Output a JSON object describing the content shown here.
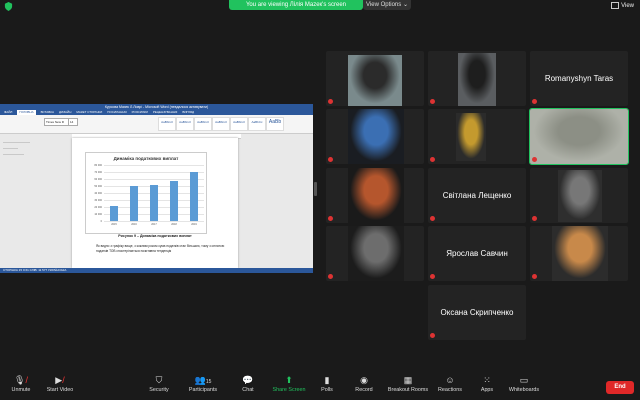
{
  "top": {
    "banner": "You are viewing Лілія Маzeк's screen",
    "view_options": "View Options ⌄",
    "view_label": "View"
  },
  "shared_screen": {
    "window_title": "Курсова Мазек Л.Ловрі - Microsoft Word (невдалося активувати)",
    "tabs": [
      "ФАЙЛ",
      "ГОЛОВНА",
      "ВСТАВКА",
      "ДИЗАЙН",
      "МАКЕТ СТОРІНКИ",
      "ПОСИЛАННЯ",
      "РОЗСИЛКИ",
      "РЕЦЕНЗУВАННЯ",
      "ВИГЛЯД"
    ],
    "font_name": "Times New R",
    "font_size": "14",
    "styles": [
      "AaBbCcI",
      "AaBbCcI",
      "AaBbCcI",
      "AaBbCcI",
      "AaBbCcI",
      "AaBbCc",
      "AaBb"
    ],
    "chart_data": {
      "type": "bar",
      "title": "Динаміка податкових виплат",
      "categories": [
        "2015",
        "2016",
        "2017",
        "2018",
        "2019"
      ],
      "values": [
        22,
        50,
        52,
        57,
        70
      ],
      "y_ticks": [
        "80 000",
        "70 000",
        "60 000",
        "50 000",
        "40 000",
        "30 000",
        "20 000",
        "10 000",
        "0"
      ],
      "ylim": [
        0,
        80
      ]
    },
    "caption": "Рисунок 9 – Динаміка податкових виплат",
    "paragraph": "Як видно з графіку вище, з кожним роком сума податків стає більшою, тому з оплатою податків ТОВ спостерігається позитивна тенденція",
    "status": "СТОРІНКА 15 З 61    СЛІВ: 11 577    УКРАЇНСЬКА"
  },
  "gallery": [
    {
      "id": "p1",
      "label": "",
      "kind": "video"
    },
    {
      "id": "p2",
      "label": "",
      "kind": "video"
    },
    {
      "id": "p3",
      "label": "Romanyshyn Taras",
      "kind": "name"
    },
    {
      "id": "p4",
      "label": "",
      "kind": "video"
    },
    {
      "id": "p5",
      "label": "",
      "kind": "video"
    },
    {
      "id": "p6",
      "label": "",
      "kind": "video"
    },
    {
      "id": "p7",
      "label": "",
      "kind": "video"
    },
    {
      "id": "p8",
      "label": "Світлана Лещенко",
      "kind": "name"
    },
    {
      "id": "p9",
      "label": "",
      "kind": "video"
    },
    {
      "id": "p10",
      "label": "",
      "kind": "video"
    },
    {
      "id": "p11",
      "label": "Ярослав Савчин",
      "kind": "name"
    },
    {
      "id": "p12",
      "label": "",
      "kind": "video"
    },
    {
      "id": "p13",
      "label": "Оксана Скрипченко",
      "kind": "name"
    }
  ],
  "toolbar": {
    "unmute": "Unmute",
    "start_video": "Start Video",
    "security": "Security",
    "participants": "Participants",
    "participants_count": "15",
    "chat": "Chat",
    "share_screen": "Share Screen",
    "polls": "Polls",
    "record": "Record",
    "breakout_rooms": "Breakout Rooms",
    "reactions": "Reactions",
    "apps": "Apps",
    "whiteboards": "Whiteboards",
    "end": "End"
  },
  "colors": {
    "zoom_green": "#21c25e",
    "end_red": "#e02828",
    "word_blue": "#2b579a",
    "bar_blue": "#5b9bd5"
  }
}
